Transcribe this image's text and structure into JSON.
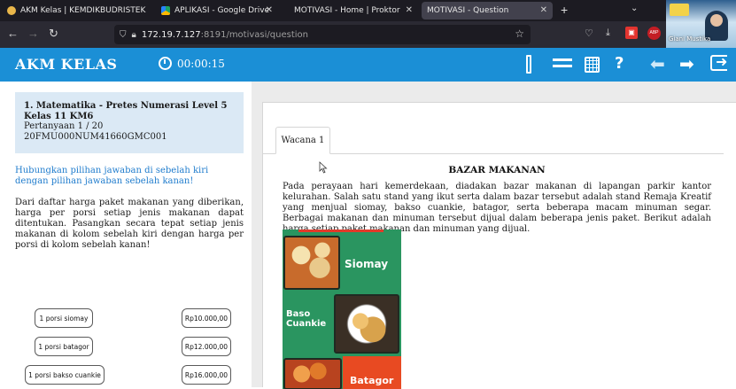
{
  "browser": {
    "tabs": [
      {
        "label": "AKM Kelas | KEMDIKBUDRISTEK",
        "active": false,
        "icon": "kemdikbud-icon"
      },
      {
        "label": "APLIKASI - Google Drive",
        "active": false,
        "icon": "google-drive-icon"
      },
      {
        "label": "MOTIVASI - Home | Proktor",
        "active": false,
        "icon": "page-icon"
      },
      {
        "label": "MOTIVASI - Question",
        "active": true,
        "icon": "page-icon"
      }
    ],
    "url_host": "172.19.7.127",
    "url_rest": ":8191/motivasi/question",
    "participant_name": "Giani Mustika"
  },
  "app": {
    "title": "AKM KELAS",
    "timer": "00:00:15",
    "accent": "#1b8fd6"
  },
  "question": {
    "subject_title": "1. Matematika - Pretes Numerasi Level 5 Kelas 11 KM6",
    "number": "Pertanyaan 1 / 20",
    "code": "20FMU000NUM41660GMC001",
    "instruction": "Hubungkan pilihan jawaban di sebelah kiri dengan pilihan jawaban sebelah kanan!",
    "description": "Dari daftar harga paket makanan yang diberikan, harga per porsi setiap jenis makanan dapat ditentukan. Pasangkan secara tepat setiap jenis makanan di kolom sebelah kiri dengan harga per porsi di kolom sebelah kanan!",
    "left_options": [
      "1 porsi siomay",
      "1 porsi batagor",
      "1 porsi bakso cuankie"
    ],
    "right_options": [
      "Rp10.000,00",
      "Rp12.000,00",
      "Rp16.000,00"
    ]
  },
  "stimulus": {
    "tab_label": "Wacana 1",
    "title": "BAZAR MAKANAN",
    "body": "Pada perayaan hari kemerdekaan, diadakan bazar makanan di lapangan parkir kantor kelurahan. Salah satu stand yang ikut serta dalam bazar tersebut adalah stand Remaja Kreatif yang menjual siomay, bakso cuankie, batagor, serta beberapa macam minuman segar. Berbagai makanan dan minuman tersebut dijual dalam beberapa jenis paket.  Berikut adalah harga setiap paket makanan dan minuman yang dijual.",
    "poster_labels": {
      "siomay": "Siomay",
      "baso_line1": "Baso",
      "baso_line2": "Cuankie",
      "batagor": "Batagor"
    }
  }
}
